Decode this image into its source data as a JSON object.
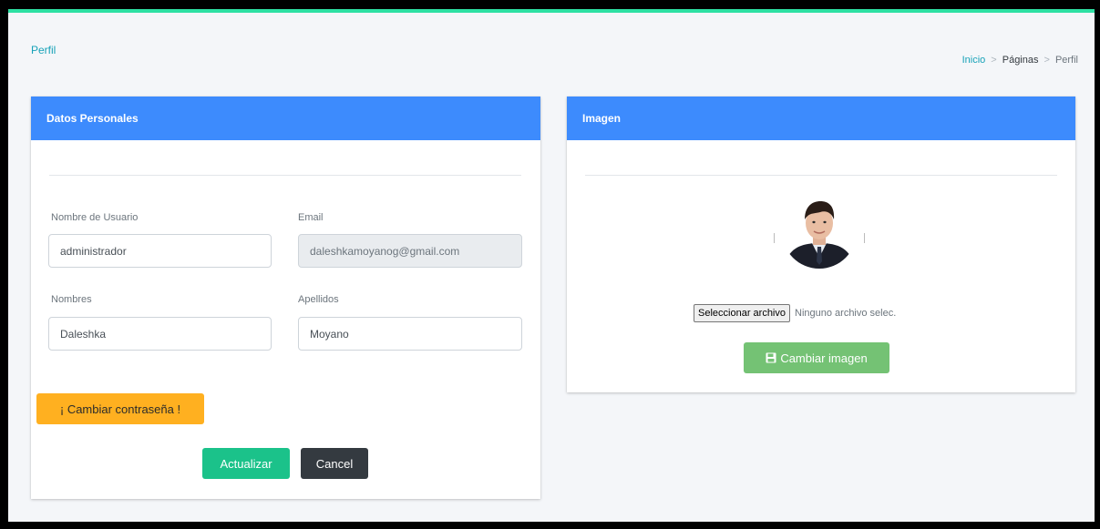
{
  "page": {
    "title": "Perfil"
  },
  "breadcrumb": {
    "items": [
      "Inicio",
      "Páginas",
      "Perfil"
    ],
    "separator": ">"
  },
  "personal": {
    "header": "Datos Personales",
    "username_label": "Nombre de Usuario",
    "username_value": "administrador",
    "email_label": "Email",
    "email_value": "daleshkamoyanog@gmail.com",
    "names_label": "Nombres",
    "names_value": "Daleshka",
    "lastnames_label": "Apellidos",
    "lastnames_value": "Moyano",
    "change_password_label": "¡ Cambiar contraseña !",
    "update_label": "Actualizar",
    "cancel_label": "Cancel"
  },
  "image": {
    "header": "Imagen",
    "file_button_label": "Seleccionar archivo",
    "file_status": "Ninguno archivo selec.",
    "change_image_label": "Cambiar imagen",
    "change_image_icon": "floppy-disk-icon"
  },
  "colors": {
    "accent_top": "#2ee0a3",
    "header_blue": "#3d8bfd",
    "warning": "#ffb020",
    "success": "#1bc28a",
    "dark": "#343a40",
    "change_image": "#5cb85c"
  }
}
